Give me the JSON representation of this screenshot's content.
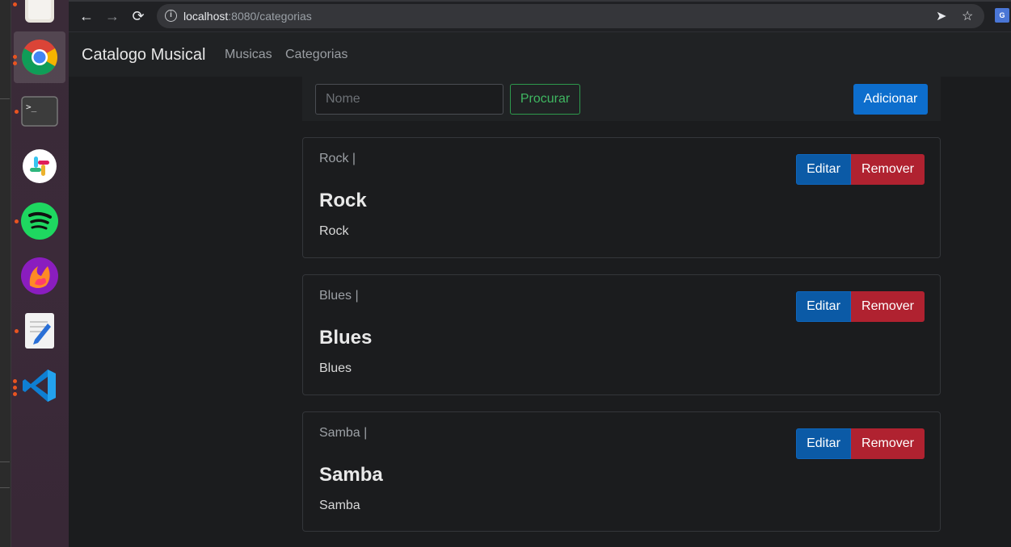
{
  "browser": {
    "url_host": "localhost",
    "url_rest": ":8080/categorias"
  },
  "navbar": {
    "brand": "Catalogo Musical",
    "links": [
      "Musicas",
      "Categorias"
    ]
  },
  "search": {
    "placeholder": "Nome",
    "search_label": "Procurar",
    "add_label": "Adicionar"
  },
  "categories": [
    {
      "subtitle": "Rock |",
      "title": "Rock",
      "text": "Rock",
      "edit_label": "Editar",
      "remove_label": "Remover"
    },
    {
      "subtitle": "Blues |",
      "title": "Blues",
      "text": "Blues",
      "edit_label": "Editar",
      "remove_label": "Remover"
    },
    {
      "subtitle": "Samba |",
      "title": "Samba",
      "text": "Samba",
      "edit_label": "Editar",
      "remove_label": "Remover"
    }
  ],
  "colors": {
    "primary": "#0d6ecd",
    "danger": "#b02230",
    "success": "#3fb761",
    "background": "#1b1c1e"
  },
  "dock_apps": [
    "files-icon",
    "chrome-icon",
    "terminal-icon",
    "slack-icon",
    "spotify-icon",
    "firefox-dev-icon",
    "text-editor-icon",
    "vscode-icon"
  ]
}
